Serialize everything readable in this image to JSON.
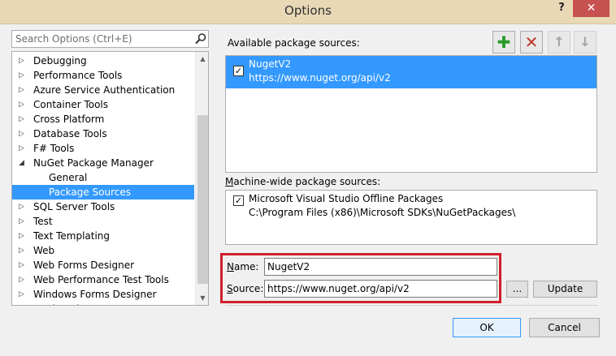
{
  "window": {
    "title": "Options",
    "help_label": "?",
    "close_label": "✕"
  },
  "search": {
    "placeholder": "Search Options (Ctrl+E)",
    "icon": "search-icon"
  },
  "tree": {
    "items": [
      {
        "label": "Debugging",
        "expander": "▷"
      },
      {
        "label": "Performance Tools",
        "expander": "▷"
      },
      {
        "label": "Azure Service Authentication",
        "expander": "▷"
      },
      {
        "label": "Container Tools",
        "expander": "▷"
      },
      {
        "label": "Cross Platform",
        "expander": "▷"
      },
      {
        "label": "Database Tools",
        "expander": "▷"
      },
      {
        "label": "F# Tools",
        "expander": "▷"
      },
      {
        "label": "NuGet Package Manager",
        "expander": "◢"
      },
      {
        "label": "General",
        "expander": ""
      },
      {
        "label": "Package Sources",
        "expander": ""
      },
      {
        "label": "SQL Server Tools",
        "expander": "▷"
      },
      {
        "label": "Test",
        "expander": "▷"
      },
      {
        "label": "Text Templating",
        "expander": "▷"
      },
      {
        "label": "Web",
        "expander": "▷"
      },
      {
        "label": "Web Forms Designer",
        "expander": "▷"
      },
      {
        "label": "Web Performance Test Tools",
        "expander": "▷"
      },
      {
        "label": "Windows Forms Designer",
        "expander": "▷"
      },
      {
        "label": "Work Projects",
        "expander": "▷"
      }
    ],
    "selected": "Package Sources",
    "scroll_up": "▲",
    "scroll_down": "▼"
  },
  "available": {
    "label": "Available package sources:",
    "sources": [
      {
        "name": "NugetV2",
        "url": "https://www.nuget.org/api/v2",
        "checked": true
      }
    ]
  },
  "toolbar": {
    "add_label": "✚",
    "remove_label": "✕",
    "up_label": "↑",
    "down_label": "↓"
  },
  "machine": {
    "label_first": "M",
    "label_rest": "achine-wide package sources:",
    "sources": [
      {
        "name": "Microsoft Visual Studio Offline Packages",
        "url": "C:\\Program Files (x86)\\Microsoft SDKs\\NuGetPackages\\",
        "checked": true
      }
    ]
  },
  "form": {
    "name_label_first": "N",
    "name_label_rest": "ame:",
    "name_value": "NugetV2",
    "source_label_first": "S",
    "source_label_rest": "ource:",
    "source_value": "https://www.nuget.org/api/v2",
    "browse_label": "...",
    "update_label": "Update"
  },
  "footer": {
    "ok_label": "OK",
    "cancel_label": "Cancel"
  },
  "colors": {
    "selection": "#3399ff",
    "highlight_box": "#d0202a",
    "titlebar": "#e8d8b6"
  }
}
